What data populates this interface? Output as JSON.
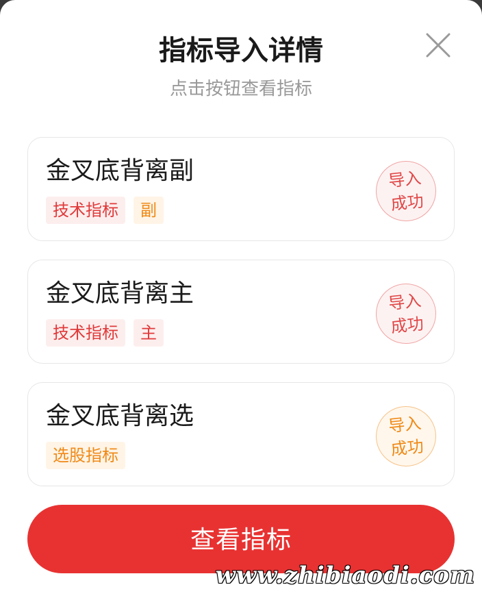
{
  "dialog": {
    "title": "指标导入详情",
    "subtitle": "点击按钮查看指标"
  },
  "indicators": [
    {
      "name": "金叉底背离副",
      "tags": [
        {
          "label": "技术指标",
          "color": "#e03a3a"
        },
        {
          "label": "副",
          "color": "#ef8a18"
        }
      ],
      "status": {
        "line1": "导入",
        "line2": "成功",
        "color": "#e04848"
      }
    },
    {
      "name": "金叉底背离主",
      "tags": [
        {
          "label": "技术指标",
          "color": "#e03a3a"
        },
        {
          "label": "主",
          "color": "#e03a3a"
        }
      ],
      "status": {
        "line1": "导入",
        "line2": "成功",
        "color": "#e04848"
      }
    },
    {
      "name": "金叉底背离选",
      "tags": [
        {
          "label": "选股指标",
          "color": "#ef8a18"
        }
      ],
      "status": {
        "line1": "导入",
        "line2": "成功",
        "color": "#ef8a18"
      }
    }
  ],
  "view_button": {
    "label": "查看指标",
    "color": "#e83232"
  },
  "watermark": "www.zhibiaodi.com"
}
